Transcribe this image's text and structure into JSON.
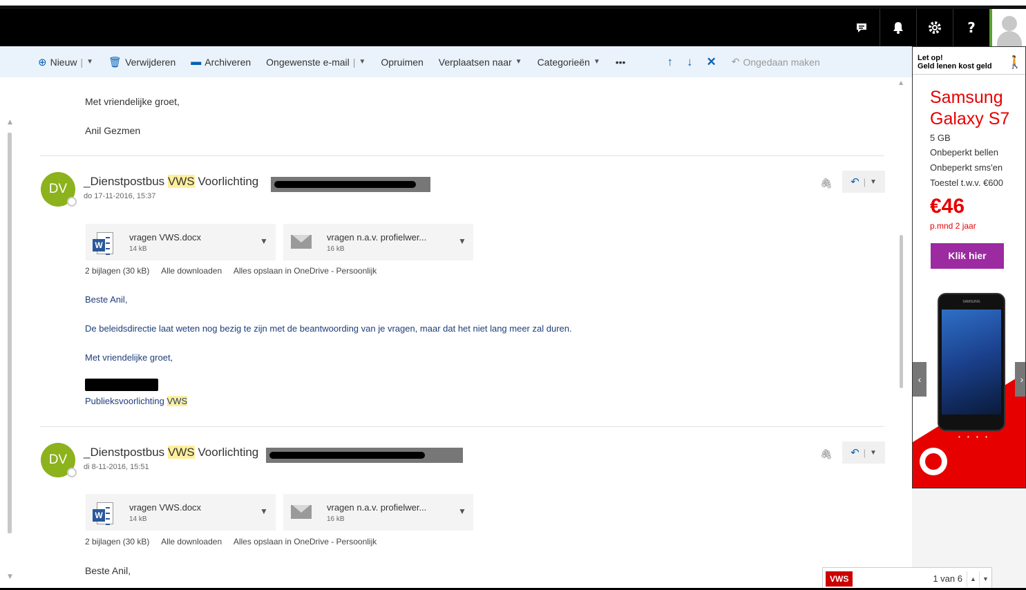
{
  "topbar": {
    "icons": [
      "chat-icon",
      "bell-icon",
      "gear-icon",
      "help-icon"
    ],
    "help_label": "?"
  },
  "command_bar": {
    "new": "Nieuw",
    "delete": "Verwijderen",
    "archive": "Archiveren",
    "junk": "Ongewenste e-mail",
    "sweep": "Opruimen",
    "move": "Verplaatsen naar",
    "categories": "Categorieën",
    "more": "•••",
    "undo": "Ongedaan maken"
  },
  "thread": {
    "prev_signoff": "Met vriendelijke groet,",
    "prev_name": "Anil Gezmen",
    "messages": [
      {
        "avatar": "DV",
        "sender_prefix": "_Dienstpostbus ",
        "sender_highlight": "VWS",
        "sender_suffix": " Voorlichting",
        "date": "do 17-11-2016, 15:37",
        "attachments": [
          {
            "name": "vragen VWS.docx",
            "size": "14 kB",
            "icon": "word-icon"
          },
          {
            "name": "vragen n.a.v. profielwer...",
            "size": "16 kB",
            "icon": "envelope-icon"
          }
        ],
        "attach_meta": {
          "count": "2 bijlagen (30 kB)",
          "download_all": "Alle downloaden",
          "save_onedrive": "Alles opslaan in OneDrive - Persoonlijk"
        },
        "greeting": "Beste Anil,",
        "body": "De beleidsdirectie laat weten nog bezig te zijn met de beantwoording van je vragen, maar dat het niet lang meer zal duren.",
        "signoff": "Met vriendelijke groet,",
        "sig_dept_prefix": "Publieksvoorlichting ",
        "sig_dept_highlight": "VWS"
      },
      {
        "avatar": "DV",
        "sender_prefix": "_Dienstpostbus ",
        "sender_highlight": "VWS",
        "sender_suffix": " Voorlichting",
        "date": "di 8-11-2016, 15:51",
        "attachments": [
          {
            "name": "vragen VWS.docx",
            "size": "14 kB",
            "icon": "word-icon"
          },
          {
            "name": "vragen n.a.v. profielwer...",
            "size": "16 kB",
            "icon": "envelope-icon"
          }
        ],
        "attach_meta": {
          "count": "2 bijlagen (30 kB)",
          "download_all": "Alle downloaden",
          "save_onedrive": "Alles opslaan in OneDrive - Persoonlijk"
        },
        "greeting": "Beste Anil,"
      }
    ]
  },
  "ad": {
    "warning_line1": "Let op!",
    "warning_line2": "Geld lenen kost geld",
    "title_line1": "Samsung",
    "title_line2": "Galaxy S7",
    "specs": [
      "5 GB",
      "Onbeperkt bellen",
      "Onbeperkt sms'en",
      "Toestel t.w.v. €600"
    ],
    "price": "€46",
    "price_term": "p.mnd 2 jaar",
    "cta": "Klik hier",
    "phone_brand": "SAMSUNG",
    "colors": {
      "brand_red": "#e60000",
      "cta_purple": "#9c2aa0"
    }
  },
  "findbar": {
    "term": "VWS",
    "count": "1 van 6"
  },
  "colors": {
    "accent": "#0a5fb4",
    "highlight": "#ffef9c",
    "avatar": "#8cb21c"
  }
}
